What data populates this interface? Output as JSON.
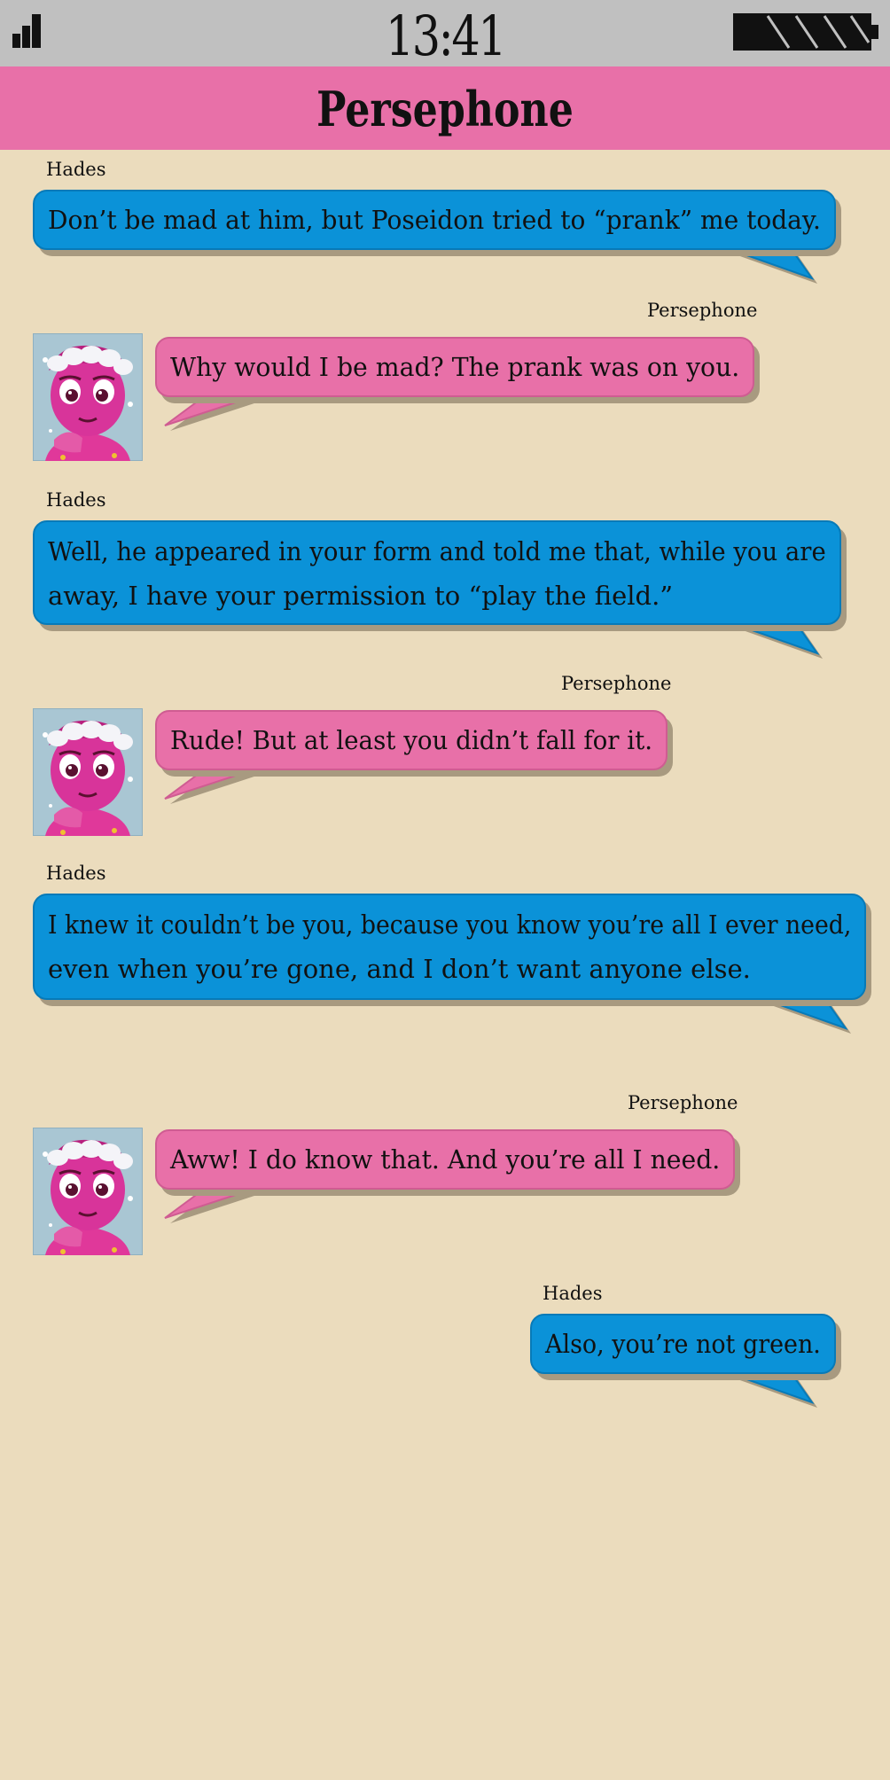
{
  "status_bar": {
    "time": "13:41",
    "signal_icon": "signal-bars-icon",
    "battery_icon": "battery-icon"
  },
  "header": {
    "title": "Persephone"
  },
  "colors": {
    "hades_bubble": "#0b92d8",
    "persephone_bubble": "#e870a8",
    "background": "#ebdcbd",
    "status_bar": "#c0c0c0"
  },
  "messages": [
    {
      "sender": "Hades",
      "lines": [
        "Don’t be mad at him, but Poseidon tried to “prank” me today."
      ]
    },
    {
      "sender": "Persephone",
      "lines": [
        "Why would I be mad? The prank was on you."
      ]
    },
    {
      "sender": "Hades",
      "lines": [
        "Well, he appeared in your form and told me that, while you are",
        "away, I have your permission to “play the field.”"
      ]
    },
    {
      "sender": "Persephone",
      "lines": [
        "Rude! But at least you didn’t fall for it."
      ]
    },
    {
      "sender": "Hades",
      "lines": [
        "I knew it couldn’t be you, because you know you’re all I ever need,",
        "even when you’re gone, and I don’t want anyone else."
      ]
    },
    {
      "sender": "Persephone",
      "lines": [
        "Aww! I do know that. And you’re all I need."
      ]
    },
    {
      "sender": "Hades",
      "lines": [
        "Also, you’re not green."
      ]
    }
  ]
}
